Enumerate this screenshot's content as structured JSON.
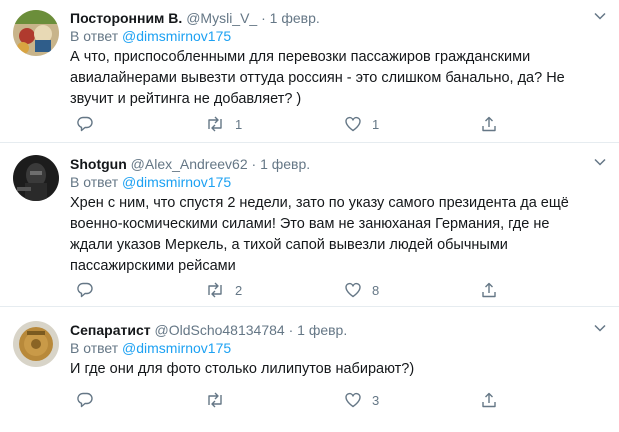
{
  "tweets": [
    {
      "name": "Посторонним В.",
      "handle": "@Mysli_V_",
      "dot": "·",
      "time": "1 февр.",
      "reply_prefix": "В ответ",
      "reply_to": "@dimsmirnov175",
      "text": "А что, приспособленными для перевозки пассажиров гражданскими\nавиалайнерами вывезти оттуда россиян - это слишком банально, да? Не\nзвучит и рейтинга не добавляет? )",
      "replies": "",
      "retweets": "1",
      "likes": "1",
      "icons": [
        "reply-icon",
        "retweet-icon",
        "like-icon",
        "share-icon",
        "chevron-down-icon"
      ]
    },
    {
      "name": "Shotgun",
      "handle": "@Alex_Andreev62",
      "dot": "·",
      "time": "1 февр.",
      "reply_prefix": "В ответ",
      "reply_to": "@dimsmirnov175",
      "text": "Хрен с ним, что спустя 2 недели, зато по указу самого президента да ещё\nвоенно-космическими силами! Это вам не занюханая Германия, где не\nждали указов Меркель, а тихой сапой вывезли людей обычными\nпассажирскими рейсами",
      "replies": "",
      "retweets": "2",
      "likes": "8",
      "icons": [
        "reply-icon",
        "retweet-icon",
        "like-icon",
        "share-icon",
        "chevron-down-icon"
      ]
    },
    {
      "name": "Сепаратист",
      "handle": "@OldScho48134784",
      "dot": "·",
      "time": "1 февр.",
      "reply_prefix": "В ответ",
      "reply_to": "@dimsmirnov175",
      "text": "И где они для фото столько лилипутов набирают?)",
      "replies": "",
      "retweets": "",
      "likes": "3",
      "icons": [
        "reply-icon",
        "retweet-icon",
        "like-icon",
        "share-icon",
        "chevron-down-icon"
      ]
    }
  ],
  "colors": {
    "text": "#14171a",
    "muted": "#657786",
    "link": "#1da1f2",
    "divider": "#e6ecf0"
  }
}
